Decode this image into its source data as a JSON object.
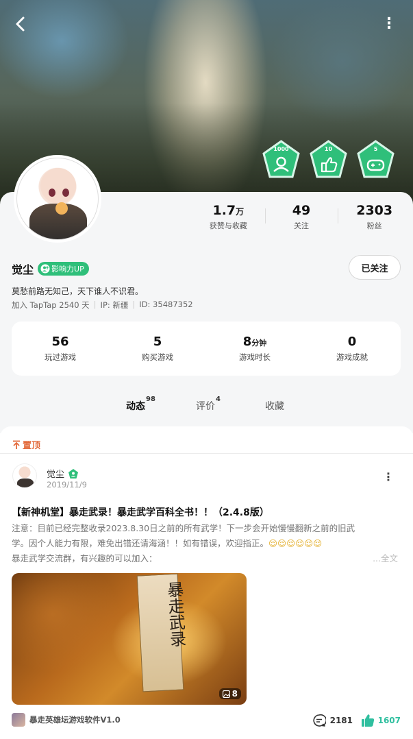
{
  "profile": {
    "name": "觉尘",
    "influence_badge": "影响力UP",
    "follow_button": "已关注",
    "bio": "莫愁前路无知己，天下谁人不识君。",
    "joined": "加入 TapTap 2540 天",
    "ip": "IP: 新疆",
    "id": "ID: 35487352"
  },
  "achievement_badges": [
    "1000",
    "10",
    "5"
  ],
  "social_stats": [
    {
      "value": "1.7",
      "unit": "万",
      "label": "获赞与收藏"
    },
    {
      "value": "49",
      "unit": "",
      "label": "关注"
    },
    {
      "value": "2303",
      "unit": "",
      "label": "粉丝"
    }
  ],
  "game_stats": [
    {
      "value": "56",
      "unit": "",
      "label": "玩过游戏"
    },
    {
      "value": "5",
      "unit": "",
      "label": "购买游戏"
    },
    {
      "value": "8",
      "unit": "分钟",
      "label": "游戏时长"
    },
    {
      "value": "0",
      "unit": "",
      "label": "游戏成就"
    }
  ],
  "tabs": [
    {
      "label": "动态",
      "count": "98"
    },
    {
      "label": "评价",
      "count": "4"
    },
    {
      "label": "收藏",
      "count": ""
    }
  ],
  "pinned_label": "置顶",
  "post": {
    "author": "觉尘",
    "date": "2019/11/9",
    "title": "【新神机堂】暴走武录！暴走武学百科全书！！（2.4.8版）",
    "body_line1": "注意：目前已经完整收录2023.8.30日之前的所有武学！下一步会开始慢慢翻新之前的旧武",
    "body_line2": "学。因个人能力有限，难免出错还请海涵！！如有错误，欢迎指正。",
    "body_emoji": "😌😌😌😌😌😌",
    "body_line3": "暴走武学交流群，有兴趣的可以加入：",
    "expand": "...全文",
    "image_text": "暴走武录",
    "image_count": "8",
    "game": "暴走英雄坛游戏软件V1.0",
    "comments": "2181",
    "likes": "1607"
  },
  "colors": {
    "accent": "#2fbf7a",
    "tab_highlight": "#53d6c5",
    "pinned": "#e26a3b",
    "like": "#2fbf9f"
  }
}
